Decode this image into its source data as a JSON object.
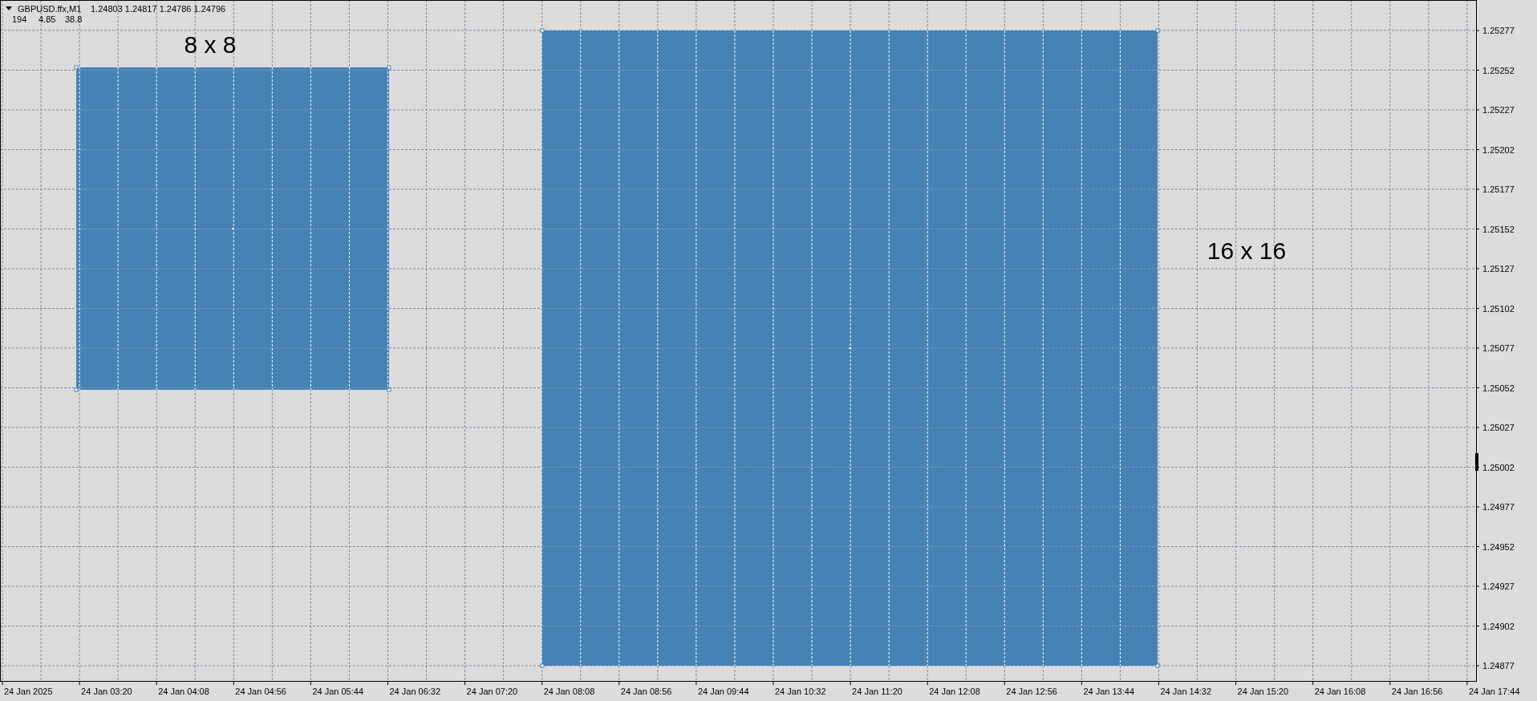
{
  "header": {
    "symbol": "GBPUSD.ffx,M1",
    "quotes": "1.24803 1.24817 1.24786 1.24796"
  },
  "indicator_values": [
    "194",
    "4.85",
    "38.8"
  ],
  "annotations": [
    {
      "text": "8 x 8"
    },
    {
      "text": "16 x 16"
    }
  ],
  "price_axis": [
    "1.25277",
    "1.25252",
    "1.25227",
    "1.25202",
    "1.25177",
    "1.25152",
    "1.25127",
    "1.25102",
    "1.25077",
    "1.25052",
    "1.25027",
    "1.25002",
    "1.24977",
    "1.24952",
    "1.24927",
    "1.24902",
    "1.24877"
  ],
  "time_axis": [
    "24 Jan 2025",
    "24 Jan 03:20",
    "24 Jan 04:08",
    "24 Jan 04:56",
    "24 Jan 05:44",
    "24 Jan 06:32",
    "24 Jan 07:20",
    "24 Jan 08:08",
    "24 Jan 08:56",
    "24 Jan 09:44",
    "24 Jan 10:32",
    "24 Jan 11:20",
    "24 Jan 12:08",
    "24 Jan 12:56",
    "24 Jan 13:44",
    "24 Jan 14:32",
    "24 Jan 15:20",
    "24 Jan 16:08",
    "24 Jan 16:56",
    "24 Jan 17:44"
  ]
}
